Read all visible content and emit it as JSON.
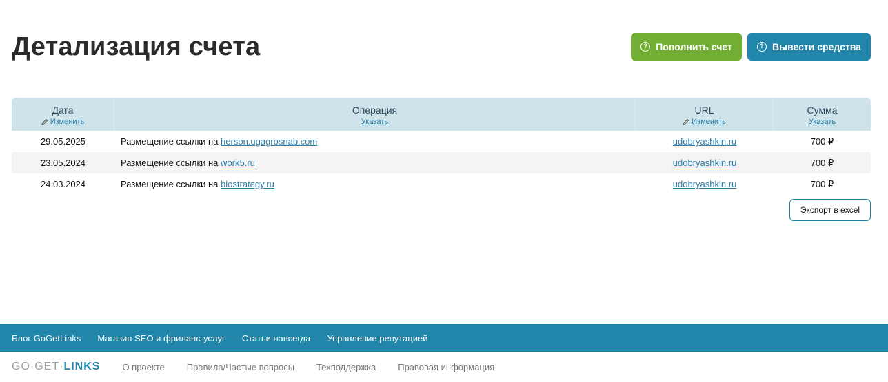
{
  "header": {
    "title": "Детализация счета",
    "deposit_label": "Пополнить счет",
    "withdraw_label": "Вывести средства",
    "colors": {
      "green": "#72ad34",
      "blue": "#2285aa"
    }
  },
  "table": {
    "columns": [
      {
        "title": "Дата",
        "link": "Изменить",
        "icon": "pencil-icon"
      },
      {
        "title": "Операция",
        "link": "Указать"
      },
      {
        "title": "URL",
        "link": "Изменить",
        "icon": "pencil-icon"
      },
      {
        "title": "Сумма",
        "link": "Указать"
      }
    ],
    "rows": [
      {
        "date": "29.05.2025",
        "op_prefix": "Размещение ссылки на",
        "op_link": "herson.ugagrosnab.com",
        "url": "udobryashkin.ru",
        "sum": "700 ₽"
      },
      {
        "date": "23.05.2024",
        "op_prefix": "Размещение ссылки на",
        "op_link": "work5.ru",
        "url": "udobryashkin.ru",
        "sum": "700 ₽"
      },
      {
        "date": "24.03.2024",
        "op_prefix": "Размещение ссылки на",
        "op_link": "biostrategy.ru",
        "url": "udobryashkin.ru",
        "sum": "700 ₽"
      }
    ]
  },
  "export_label": "Экспорт в excel",
  "footer": {
    "top_links": [
      "Блог GoGetLinks",
      "Магазин SEO и фриланс-услуг",
      "Статьи навсегда",
      "Управление репутацией"
    ],
    "logo_left": "GO·GET·",
    "logo_right": "LINKS",
    "bottom_links": [
      "О проекте",
      "Правила/Частые вопросы",
      "Техподдержка",
      "Правовая информация"
    ]
  }
}
